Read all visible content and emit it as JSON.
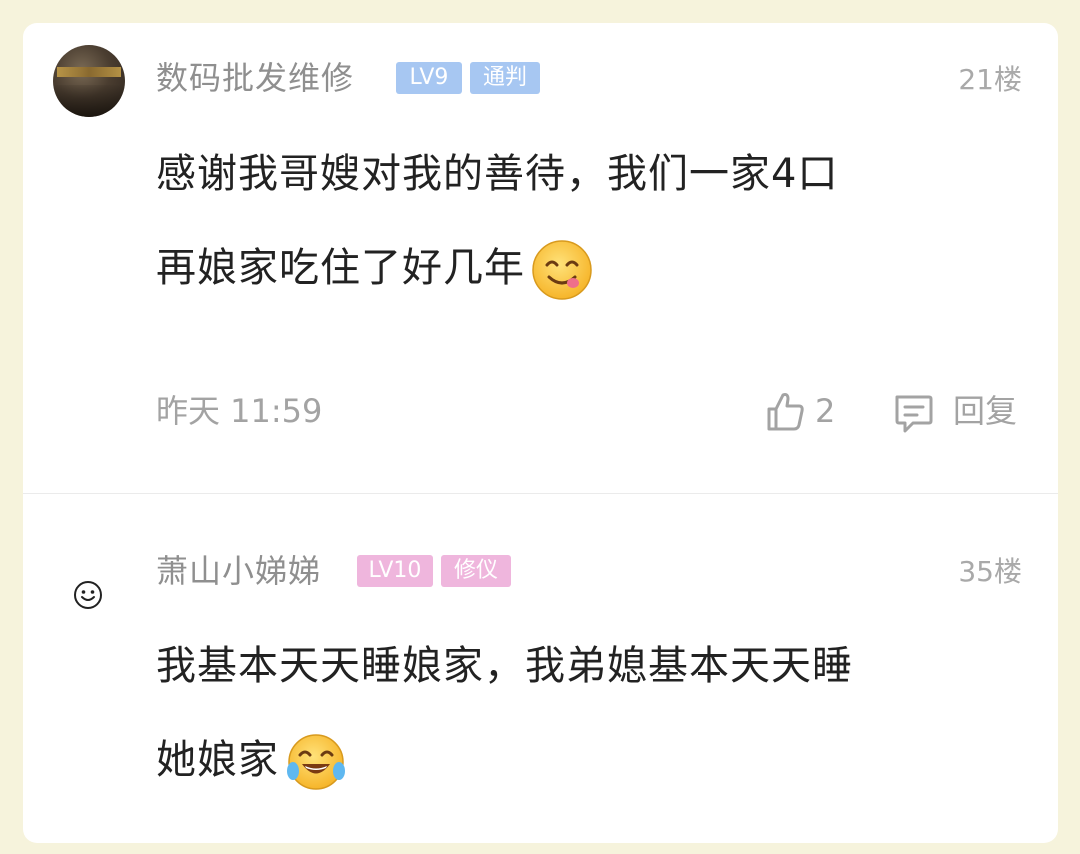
{
  "comments": [
    {
      "username": "数码批发维修",
      "level": "LV9",
      "title_badge": "通判",
      "floor": "21楼",
      "text_line1": "感谢我哥嫂对我的善待，我们一家4口",
      "text_line2": "再娘家吃住了好几年",
      "emoji": "yum-face-icon",
      "timestamp": "昨天 11:59",
      "likes": "2",
      "reply_label": "回复"
    },
    {
      "username": "萧山小娣娣",
      "level": "LV10",
      "title_badge": "修仪",
      "floor": "35楼",
      "text_line1": "我基本天天睡娘家，我弟媳基本天天睡",
      "text_line2": "她娘家",
      "emoji": "tears-of-joy-icon"
    }
  ],
  "colors": {
    "page_bg": "#f6f3dc",
    "card_bg": "#ffffff",
    "badge_blue": "#a7c7f2",
    "badge_pink": "#efb6dd"
  }
}
